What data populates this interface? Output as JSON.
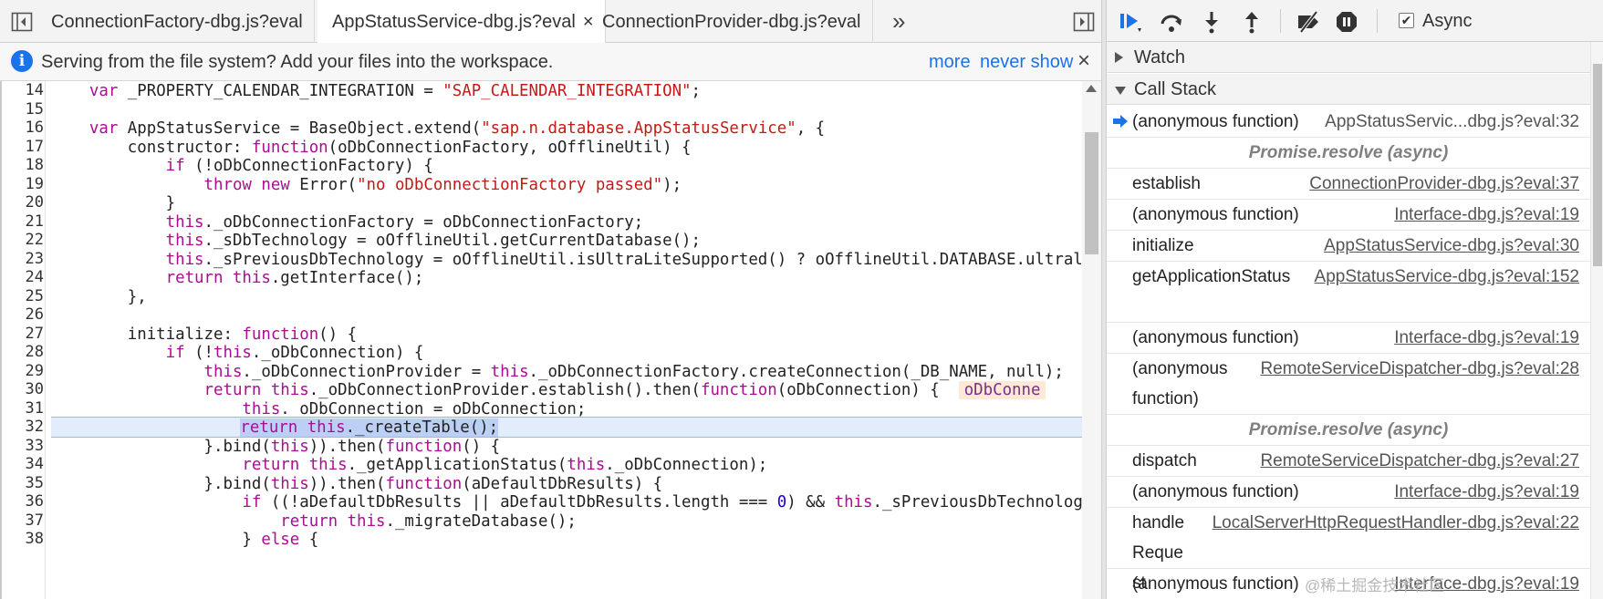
{
  "tabs": [
    {
      "label": "ConnectionFactory-dbg.js?eval",
      "active": false,
      "closable": false
    },
    {
      "label": "AppStatusService-dbg.js?eval",
      "active": true,
      "closable": true
    },
    {
      "label": "ConnectionProvider-dbg.js?eval",
      "active": false,
      "closable": false
    }
  ],
  "tab_close_glyph": "×",
  "tab_overflow_glyph": "»",
  "infobar": {
    "icon": "i",
    "message": "Serving from the file system? Add your files into the workspace.",
    "more_label": "more",
    "never_show_label": "never show",
    "close_glyph": "×"
  },
  "code": {
    "first_line": 14,
    "current_line": 32,
    "line_numbers": [
      "14",
      "15",
      "16",
      "17",
      "18",
      "19",
      "20",
      "21",
      "22",
      "23",
      "24",
      "25",
      "26",
      "27",
      "28",
      "29",
      "30",
      "31",
      "32",
      "33",
      "34",
      "35",
      "36",
      "37",
      "38"
    ],
    "inline_value": "oDbConne"
  },
  "debugger": {
    "async_checked_glyph": "✔",
    "async_label": "Async",
    "watch_label": "Watch",
    "callstack_label": "Call Stack",
    "frames": [
      {
        "name": "(anonymous function)",
        "location": "AppStatusServic...dbg.js?eval:32",
        "current": true
      },
      {
        "separator": "Promise.resolve (async)"
      },
      {
        "name": "establish",
        "location": "ConnectionProvider-dbg.js?eval:37"
      },
      {
        "name": "(anonymous function)",
        "location": "Interface-dbg.js?eval:19"
      },
      {
        "name": "initialize",
        "location": "AppStatusService-dbg.js?eval:30"
      },
      {
        "name": "getApplicationStatus",
        "location": "AppStatusService-dbg.js?eval:152"
      },
      {
        "name": "(anonymous function)",
        "location": "Interface-dbg.js?eval:19"
      },
      {
        "name": "(anonymous function)",
        "location": "RemoteServiceDispatcher-dbg.js?eval:28"
      },
      {
        "separator": "Promise.resolve (async)"
      },
      {
        "name": "dispatch",
        "location": "RemoteServiceDispatcher-dbg.js?eval:27"
      },
      {
        "name": "(anonymous function)",
        "location": "Interface-dbg.js?eval:19"
      },
      {
        "name": "handleRequest",
        "location": "LocalServerHttpRequestHandler-dbg.js?eval:22"
      },
      {
        "name": "(anonymous function)",
        "location": "Interface-dbg.js?eval:19"
      }
    ]
  },
  "watermark": "@稀土掘金技术社区",
  "colors": {
    "accent_blue": "#1a73e8",
    "keyword": "#aa0d91",
    "string": "#c41a16",
    "number": "#1c00cf",
    "exec_line_bg": "#e3ecfa",
    "async_separator": "#7f7f7f"
  }
}
